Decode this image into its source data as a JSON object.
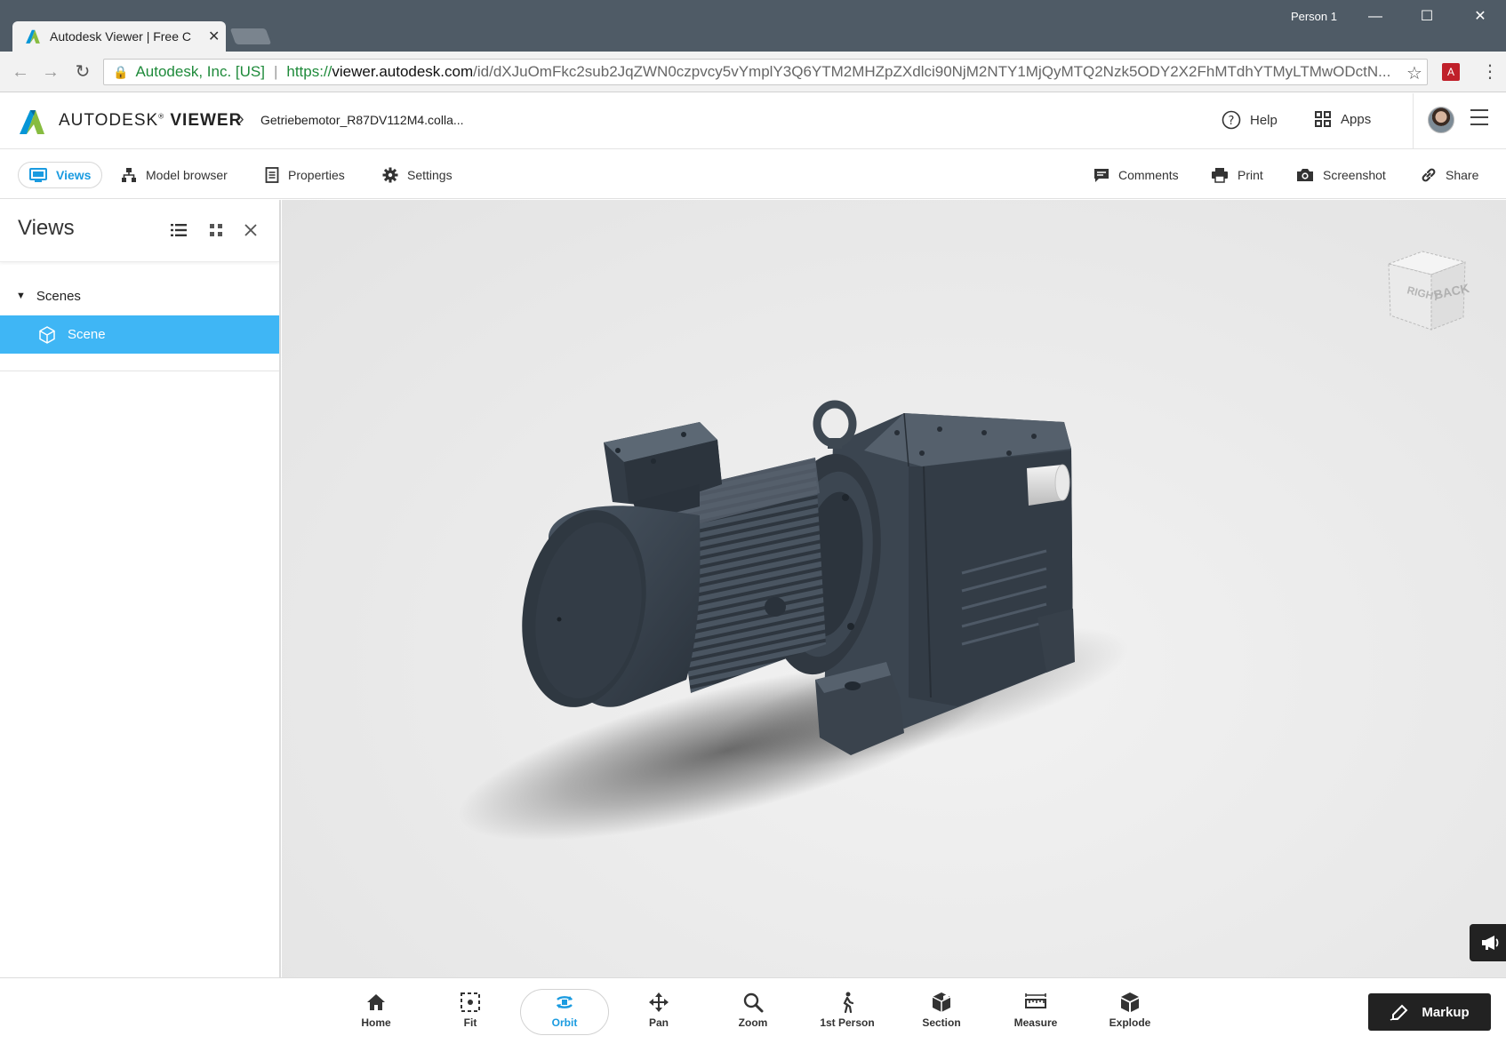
{
  "browser": {
    "tab_title": "Autodesk Viewer | Free C",
    "tab_close": "✕",
    "profile_name": "Person 1",
    "window_controls": {
      "minimize": "—",
      "maximize": "☐",
      "close": "✕"
    },
    "nav": {
      "back": "←",
      "forward": "→",
      "reload": "↻"
    },
    "address": {
      "lock": "🔒",
      "site_label": "Autodesk, Inc. [US]",
      "separator": "|",
      "url_scheme": "https://",
      "url_host": "viewer.autodesk.com",
      "url_path": "/id/dXJuOmFkc2sub2JqZWN0czpvcy5vYmplY3Q6YTM2MHZpZXdlci90NjM2NTY1MjQyMTQ2Nzk5ODY2X2FhMTdhYTMyLTMwODctN..."
    },
    "icons": {
      "star": "☆",
      "pdf": "A",
      "menu": "⋮"
    }
  },
  "header": {
    "brand_light": "AUTODESK",
    "brand_mark": "®",
    "brand_bold": "VIEWER",
    "crumb_chevron": "›",
    "file_name": "Getriebemotor_R87DV112M4.colla...",
    "help_label": "Help",
    "apps_label": "Apps"
  },
  "toolbar": {
    "views": "Views",
    "model_browser": "Model browser",
    "properties": "Properties",
    "settings": "Settings",
    "comments": "Comments",
    "print": "Print",
    "screenshot": "Screenshot",
    "share": "Share"
  },
  "panel": {
    "title": "Views",
    "group": {
      "label": "Scenes",
      "caret": "▼"
    },
    "items": [
      {
        "label": "Scene",
        "selected": true
      }
    ]
  },
  "viewcube": {
    "faces": [
      "RIGHT",
      "BACK"
    ]
  },
  "bottom_toolbar": {
    "home": "Home",
    "fit": "Fit",
    "orbit": "Orbit",
    "pan": "Pan",
    "zoom": "Zoom",
    "first_person": "1st Person",
    "section": "Section",
    "measure": "Measure",
    "explode": "Explode",
    "markup": "Markup",
    "active_tool": "Orbit"
  },
  "colors": {
    "accent": "#1a9be0",
    "selection": "#3fb6f5",
    "chrome": "#4f5b66",
    "model": "#3f4a56"
  }
}
